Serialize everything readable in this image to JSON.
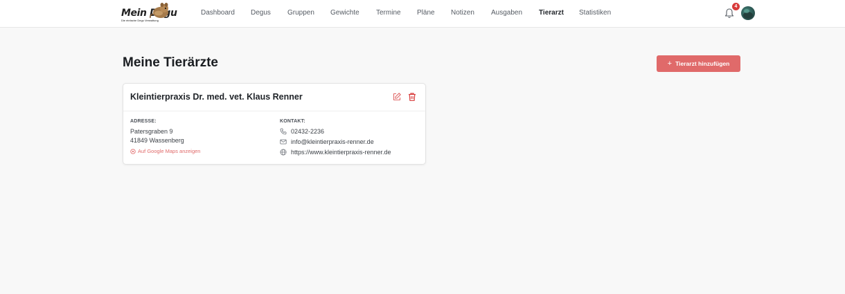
{
  "brand": {
    "name": "Mein Degu",
    "tagline": "Die einfache Degu Verwaltung"
  },
  "nav": {
    "items": [
      {
        "label": "Dashboard"
      },
      {
        "label": "Degus"
      },
      {
        "label": "Gruppen"
      },
      {
        "label": "Gewichte"
      },
      {
        "label": "Termine"
      },
      {
        "label": "Pläne"
      },
      {
        "label": "Notizen"
      },
      {
        "label": "Ausgaben"
      },
      {
        "label": "Tierarzt"
      },
      {
        "label": "Statistiken"
      }
    ],
    "active": "Tierarzt"
  },
  "header": {
    "notification_count": "4",
    "icons": [
      "bell-icon",
      "avatar"
    ]
  },
  "page": {
    "title": "Meine Tierärzte",
    "add_button": {
      "label": "Tierarzt hinzufügen",
      "icon": "plus-icon"
    }
  },
  "vet": {
    "name": "Kleintierpraxis Dr. med. vet. Klaus Renner",
    "address_label": "ADRESSE:",
    "street": "Patersgraben 9",
    "city": "41849 Wassenberg",
    "maps_link": "Auf Google Maps anzeigen",
    "contact_label": "KONTAKT:",
    "phone": "02432-2236",
    "email": "info@kleintierpraxis-renner.de",
    "website": "https://www.kleintierpraxis-renner.de",
    "actions": [
      "edit-icon",
      "trash-icon"
    ]
  },
  "colors": {
    "accent": "#e06a6a",
    "background": "#f8f8f8",
    "badge": "#d83a3a"
  }
}
